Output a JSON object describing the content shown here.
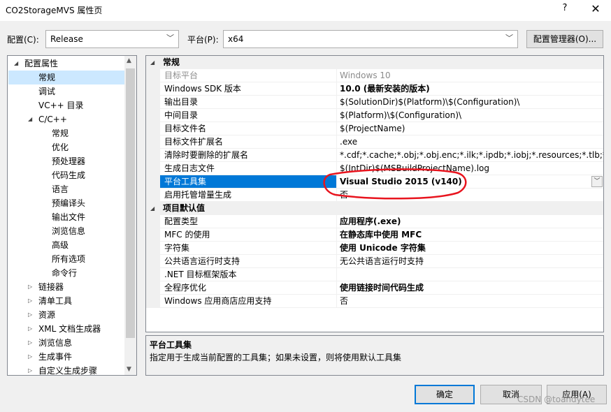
{
  "window": {
    "title": "CO2StorageMVS 属性页",
    "help": "?",
    "close": "✕"
  },
  "toolbar": {
    "config_label": "配置(C):",
    "config_value": "Release",
    "platform_label": "平台(P):",
    "platform_value": "x64",
    "config_manager": "配置管理器(O)..."
  },
  "tree": [
    {
      "label": "配置属性",
      "expander": "◢",
      "level": 0
    },
    {
      "label": "常规",
      "level": 1,
      "selected": true
    },
    {
      "label": "调试",
      "level": 1
    },
    {
      "label": "VC++ 目录",
      "level": 1
    },
    {
      "label": "C/C++",
      "expander": "◢",
      "level": 1
    },
    {
      "label": "常规",
      "level": 2
    },
    {
      "label": "优化",
      "level": 2
    },
    {
      "label": "预处理器",
      "level": 2
    },
    {
      "label": "代码生成",
      "level": 2
    },
    {
      "label": "语言",
      "level": 2
    },
    {
      "label": "预编译头",
      "level": 2
    },
    {
      "label": "输出文件",
      "level": 2
    },
    {
      "label": "浏览信息",
      "level": 2
    },
    {
      "label": "高级",
      "level": 2
    },
    {
      "label": "所有选项",
      "level": 2
    },
    {
      "label": "命令行",
      "level": 2
    },
    {
      "label": "链接器",
      "expander": "▷",
      "level": 1
    },
    {
      "label": "清单工具",
      "expander": "▷",
      "level": 1
    },
    {
      "label": "资源",
      "expander": "▷",
      "level": 1
    },
    {
      "label": "XML 文档生成器",
      "expander": "▷",
      "level": 1
    },
    {
      "label": "浏览信息",
      "expander": "▷",
      "level": 1
    },
    {
      "label": "生成事件",
      "expander": "▷",
      "level": 1
    },
    {
      "label": "自定义生成步骤",
      "expander": "▷",
      "level": 1
    }
  ],
  "grid": {
    "category_general": "常规",
    "category_defaults": "项目默认值",
    "general": [
      {
        "name": "目标平台",
        "value": "Windows 10",
        "style": "gray"
      },
      {
        "name": "Windows SDK 版本",
        "value": "10.0 (最新安装的版本)",
        "style": "bold"
      },
      {
        "name": "输出目录",
        "value": "$(SolutionDir)$(Platform)\\$(Configuration)\\"
      },
      {
        "name": "中间目录",
        "value": "$(Platform)\\$(Configuration)\\"
      },
      {
        "name": "目标文件名",
        "value": "$(ProjectName)"
      },
      {
        "name": "目标文件扩展名",
        "value": ".exe"
      },
      {
        "name": "清除时要删除的扩展名",
        "value": "*.cdf;*.cache;*.obj;*.obj.enc;*.ilk;*.ipdb;*.iobj;*.resources;*.tlb;*.tli;*.t"
      },
      {
        "name": "生成日志文件",
        "value": "$(IntDir)$(MSBuildProjectName).log"
      },
      {
        "name": "平台工具集",
        "value": "Visual Studio 2015 (v140)",
        "style": "selected"
      },
      {
        "name": "启用托管增量生成",
        "value": "否"
      }
    ],
    "defaults": [
      {
        "name": "配置类型",
        "value": "应用程序(.exe)",
        "style": "bold"
      },
      {
        "name": "MFC 的使用",
        "value": "在静态库中使用 MFC",
        "style": "bold"
      },
      {
        "name": "字符集",
        "value": "使用 Unicode 字符集",
        "style": "bold"
      },
      {
        "name": "公共语言运行时支持",
        "value": "无公共语言运行时支持"
      },
      {
        "name": ".NET 目标框架版本",
        "value": ""
      },
      {
        "name": "全程序优化",
        "value": "使用链接时间代码生成",
        "style": "bold"
      },
      {
        "name": "Windows 应用商店应用支持",
        "value": "否"
      }
    ]
  },
  "description": {
    "title": "平台工具集",
    "text": "指定用于生成当前配置的工具集；如果未设置，则将使用默认工具集"
  },
  "buttons": {
    "ok": "确定",
    "cancel": "取消",
    "apply": "应用(A)"
  },
  "watermark": "CSDN @toandytee",
  "colors": {
    "selection": "#0078d7",
    "annotation": "#e8141e",
    "tree_selection": "#cce8ff"
  }
}
